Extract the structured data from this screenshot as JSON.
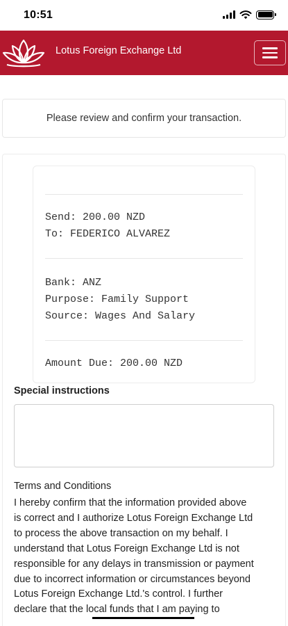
{
  "status_bar": {
    "time": "10:51"
  },
  "header": {
    "brand": "Lotus Foreign Exchange Ltd",
    "logo_icon": "lotus-flower-icon",
    "menu_icon": "hamburger-icon",
    "background": "#b3182e"
  },
  "notice": {
    "text": "Please review and confirm your transaction."
  },
  "receipt": {
    "send": "Send: 200.00 NZD",
    "to": "To: FEDERICO ALVAREZ",
    "bank": "Bank: ANZ",
    "purpose": "Purpose: Family Support",
    "source": "Source: Wages And Salary",
    "amount_due": "Amount Due: 200.00 NZD"
  },
  "special_instructions": {
    "label": "Special instructions",
    "value": ""
  },
  "terms": {
    "title": "Terms and Conditions",
    "lines": [
      "I hereby confirm that the information provided above",
      "is correct and I authorize Lotus Foreign Exchange Ltd",
      "to process the above transaction on my behalf. I",
      "understand that Lotus Foreign Exchange Ltd is not",
      "responsible for any delays in transmission or payment",
      "due to incorrect information or circumstances beyond",
      "Lotus Foreign Exchange Ltd.'s control. I further",
      "declare that the local funds that I am paying to"
    ]
  }
}
